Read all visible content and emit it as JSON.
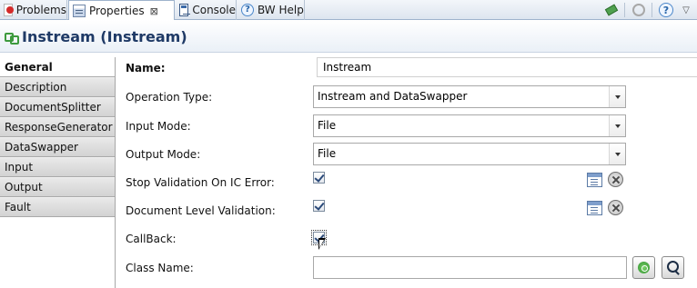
{
  "tabs": [
    {
      "label": "Problems",
      "icon": "problems-icon"
    },
    {
      "label": "Properties",
      "icon": "properties-icon",
      "active": true,
      "close": "⊠"
    },
    {
      "label": "Console",
      "icon": "console-icon"
    },
    {
      "label": "BW Help",
      "icon": "help-icon"
    }
  ],
  "toolbar": {
    "help_glyph": "?",
    "menu_glyph": "▽"
  },
  "title": "Instream (Instream)",
  "sidebar": {
    "items": [
      {
        "label": "General",
        "active": true
      },
      {
        "label": "Description"
      },
      {
        "label": "DocumentSplitter"
      },
      {
        "label": "ResponseGenerator"
      },
      {
        "label": "DataSwapper"
      },
      {
        "label": "Input"
      },
      {
        "label": "Output"
      },
      {
        "label": "Fault"
      }
    ]
  },
  "form": {
    "name": {
      "label": "Name:",
      "value": "Instream"
    },
    "operation_type": {
      "label": "Operation Type:",
      "value": "Instream and DataSwapper"
    },
    "input_mode": {
      "label": "Input Mode:",
      "value": "File"
    },
    "output_mode": {
      "label": "Output Mode:",
      "value": "File"
    },
    "stop_validation": {
      "label": "Stop Validation On IC Error:",
      "checked": true
    },
    "doc_validation": {
      "label": "Document Level Validation:",
      "checked": true
    },
    "callback": {
      "label": "CallBack:",
      "checked": true
    },
    "class_name": {
      "label": "Class Name:",
      "value": ""
    }
  },
  "colors": {
    "title": "#1f3a66",
    "tab_border": "#9fb3cc"
  }
}
